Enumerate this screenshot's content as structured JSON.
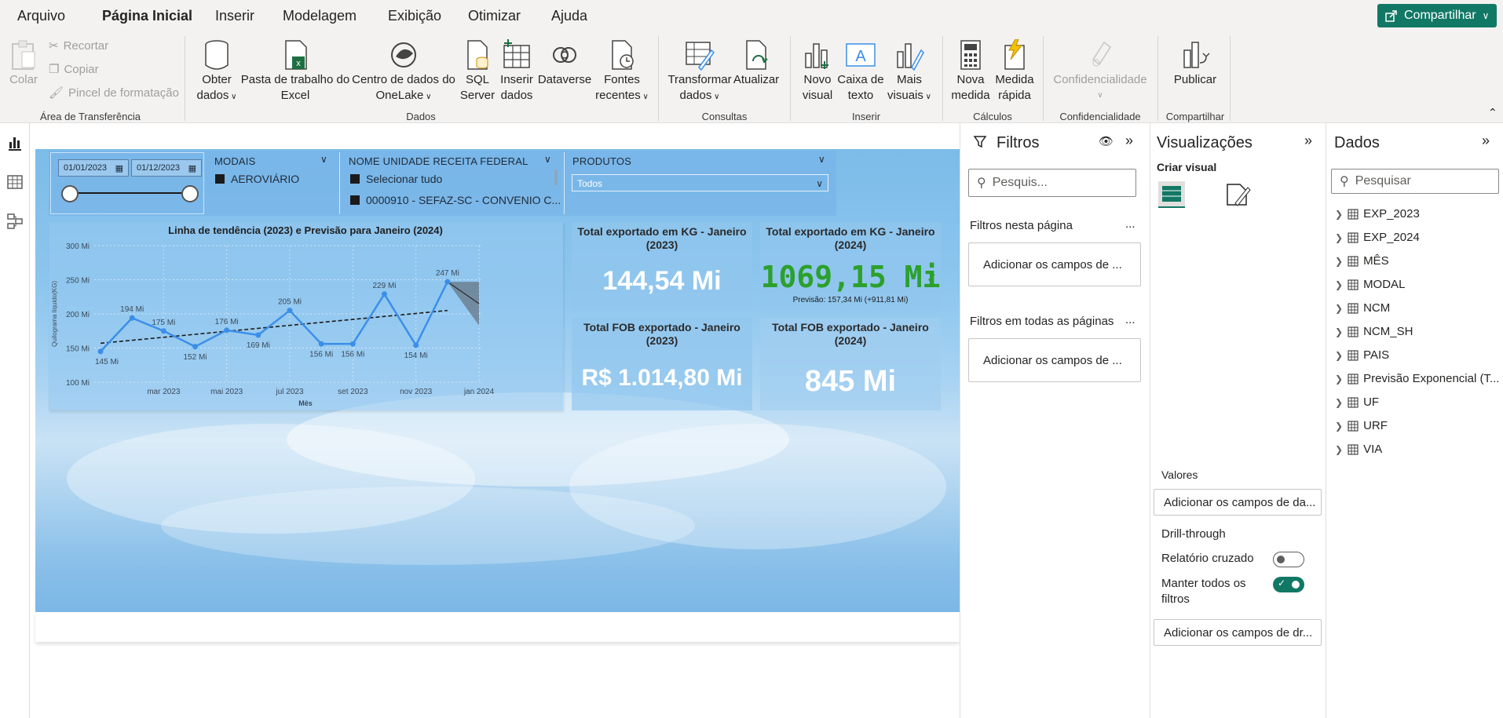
{
  "menu": {
    "items": [
      "Arquivo",
      "Página Inicial",
      "Inserir",
      "Modelagem",
      "Exibição",
      "Otimizar",
      "Ajuda"
    ],
    "share": "Compartilhar"
  },
  "ribbon": {
    "clipboard": {
      "paste": "Colar",
      "cut": "Recortar",
      "copy": "Copiar",
      "format_painter": "Pincel de formatação",
      "title": "Área de Transferência"
    },
    "data": {
      "get_data": [
        "Obter",
        "dados"
      ],
      "excel": [
        "Pasta de trabalho do",
        "Excel"
      ],
      "onelake": [
        "Centro de dados do",
        "OneLake"
      ],
      "sql": [
        "SQL",
        "Server"
      ],
      "enter": [
        "Inserir",
        "dados"
      ],
      "dataverse": "Dataverse",
      "recent": [
        "Fontes",
        "recentes"
      ],
      "title": "Dados"
    },
    "queries": {
      "transform": [
        "Transformar",
        "dados"
      ],
      "refresh": "Atualizar",
      "title": "Consultas"
    },
    "insert": {
      "new_visual": [
        "Novo",
        "visual"
      ],
      "text_box": [
        "Caixa de",
        "texto"
      ],
      "more_visuals": [
        "Mais",
        "visuais"
      ],
      "title": "Inserir"
    },
    "calc": {
      "new_measure": [
        "Nova",
        "medida"
      ],
      "quick_measure": [
        "Medida",
        "rápida"
      ],
      "title": "Cálculos"
    },
    "sensitivity": {
      "label": "Confidencialidade",
      "title": "Confidencialidade"
    },
    "share": {
      "publish": "Publicar",
      "title": "Compartilhar"
    }
  },
  "report": {
    "date_slicer": {
      "start": "01/01/2023",
      "end": "01/12/2023"
    },
    "modais": {
      "title": "MODAIS",
      "items": [
        "AEROVIÁRIO"
      ]
    },
    "unidade": {
      "title": "NOME UNIDADE RECEITA FEDERAL",
      "items": [
        "Selecionar tudo",
        "0000910 - SEFAZ-SC - CONVENIO C..."
      ]
    },
    "produtos": {
      "title": "PRODUTOS",
      "value": "Todos"
    },
    "cards": [
      {
        "title": "Total exportado em KG - Janeiro (2023)",
        "value": "144,54 Mi"
      },
      {
        "title": "Total exportado em KG - Janeiro (2024)",
        "value": "1069,15 Mi",
        "subtitle": "Previsão: 157,34 Mi (+911,81 Mi)"
      },
      {
        "title": "Total FOB exportado - Janeiro (2023)",
        "value": "R$ 1.014,80 Mi"
      },
      {
        "title": "Total FOB exportado - Janeiro (2024)",
        "value": "845 Mi"
      }
    ],
    "colors": {
      "kpi_green": "#2ca02c",
      "line": "#3b8fe8"
    }
  },
  "chart_data": {
    "type": "line",
    "title": "Linha de tendência (2023) e Previsão para Janeiro (2024)",
    "xlabel": "Mês",
    "ylabel": "Quilograma líquido(KG)",
    "x": [
      "jan 2023",
      "fev 2023",
      "mar 2023",
      "abr 2023",
      "mai 2023",
      "jun 2023",
      "jul 2023",
      "ago 2023",
      "set 2023",
      "out 2023",
      "nov 2023",
      "dez 2023"
    ],
    "x_ticks": [
      "mar 2023",
      "mai 2023",
      "jul 2023",
      "set 2023",
      "nov 2023",
      "jan 2024"
    ],
    "y_ticks": [
      "100 Mi",
      "150 Mi",
      "200 Mi",
      "250 Mi",
      "300 Mi"
    ],
    "ylim": [
      100,
      300
    ],
    "series": [
      {
        "values": [
          145,
          194,
          175,
          152,
          176,
          169,
          205,
          156,
          156,
          229,
          154,
          247
        ]
      }
    ],
    "data_labels": [
      "145 Mi",
      "194 Mi",
      "175 Mi",
      "152 Mi",
      "176 Mi",
      "169 Mi",
      "205 Mi",
      "156 Mi",
      "156 Mi",
      "229 Mi",
      "154 Mi",
      "247 Mi"
    ],
    "trend": {
      "start": 157,
      "end": 205
    },
    "forecast": {
      "x": "jan 2024",
      "value": 215,
      "lower": 183,
      "upper": 247
    }
  },
  "filters": {
    "title": "Filtros",
    "search": "Pesquis...",
    "this_page": "Filtros nesta página",
    "all_pages": "Filtros em todas as páginas",
    "add_fields": "Adicionar os campos de ...",
    "more": "..."
  },
  "visualizations": {
    "title": "Visualizações",
    "create": "Criar visual",
    "values": "Valores",
    "values_add": "Adicionar os campos de da...",
    "drill": "Drill-through",
    "cross_report": "Relatório cruzado",
    "keep_filters": [
      "Manter todos os",
      "filtros"
    ],
    "drill_add": "Adicionar os campos de dr..."
  },
  "data_pane": {
    "title": "Dados",
    "search": "Pesquisar",
    "tables": [
      "EXP_2023",
      "EXP_2024",
      "MÊS",
      "MODAL",
      "NCM",
      "NCM_SH",
      "PAIS",
      "Previsão Exponencial (T...",
      "UF",
      "URF",
      "VIA"
    ]
  }
}
